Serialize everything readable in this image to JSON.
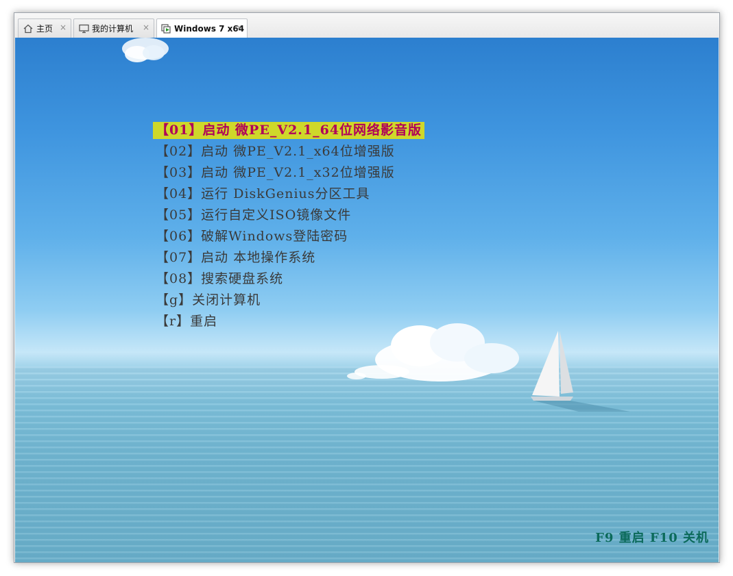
{
  "tabs": [
    {
      "label": "主页",
      "icon": "home-icon"
    },
    {
      "label": "我的计算机",
      "icon": "monitor-icon"
    },
    {
      "label": "Windows 7 x64",
      "icon": "vm-running-icon",
      "active": true
    }
  ],
  "tab_close_glyph": "×",
  "boot_menu": {
    "items": [
      "【01】启动 微PE_V2.1_64位网络影音版",
      "【02】启动 微PE_V2.1_x64位增强版",
      "【03】启动 微PE_V2.1_x32位增强版",
      "【04】运行 DiskGenius分区工具",
      "【05】运行自定义ISO镜像文件",
      "【06】破解Windows登陆密码",
      "【07】启动 本地操作系统",
      "【08】搜索硬盘系统",
      "【g】关闭计算机",
      "【r】重启"
    ],
    "selected_index": 0,
    "selected_bg": "#cfd82a",
    "selected_fg": "#b0005a"
  },
  "hotkeys": "F9 重启  F10 关机",
  "colors": {
    "hotkey": "#0b6a5a",
    "sky_top": "#2c7fcf",
    "sea": "#73b7d2"
  }
}
